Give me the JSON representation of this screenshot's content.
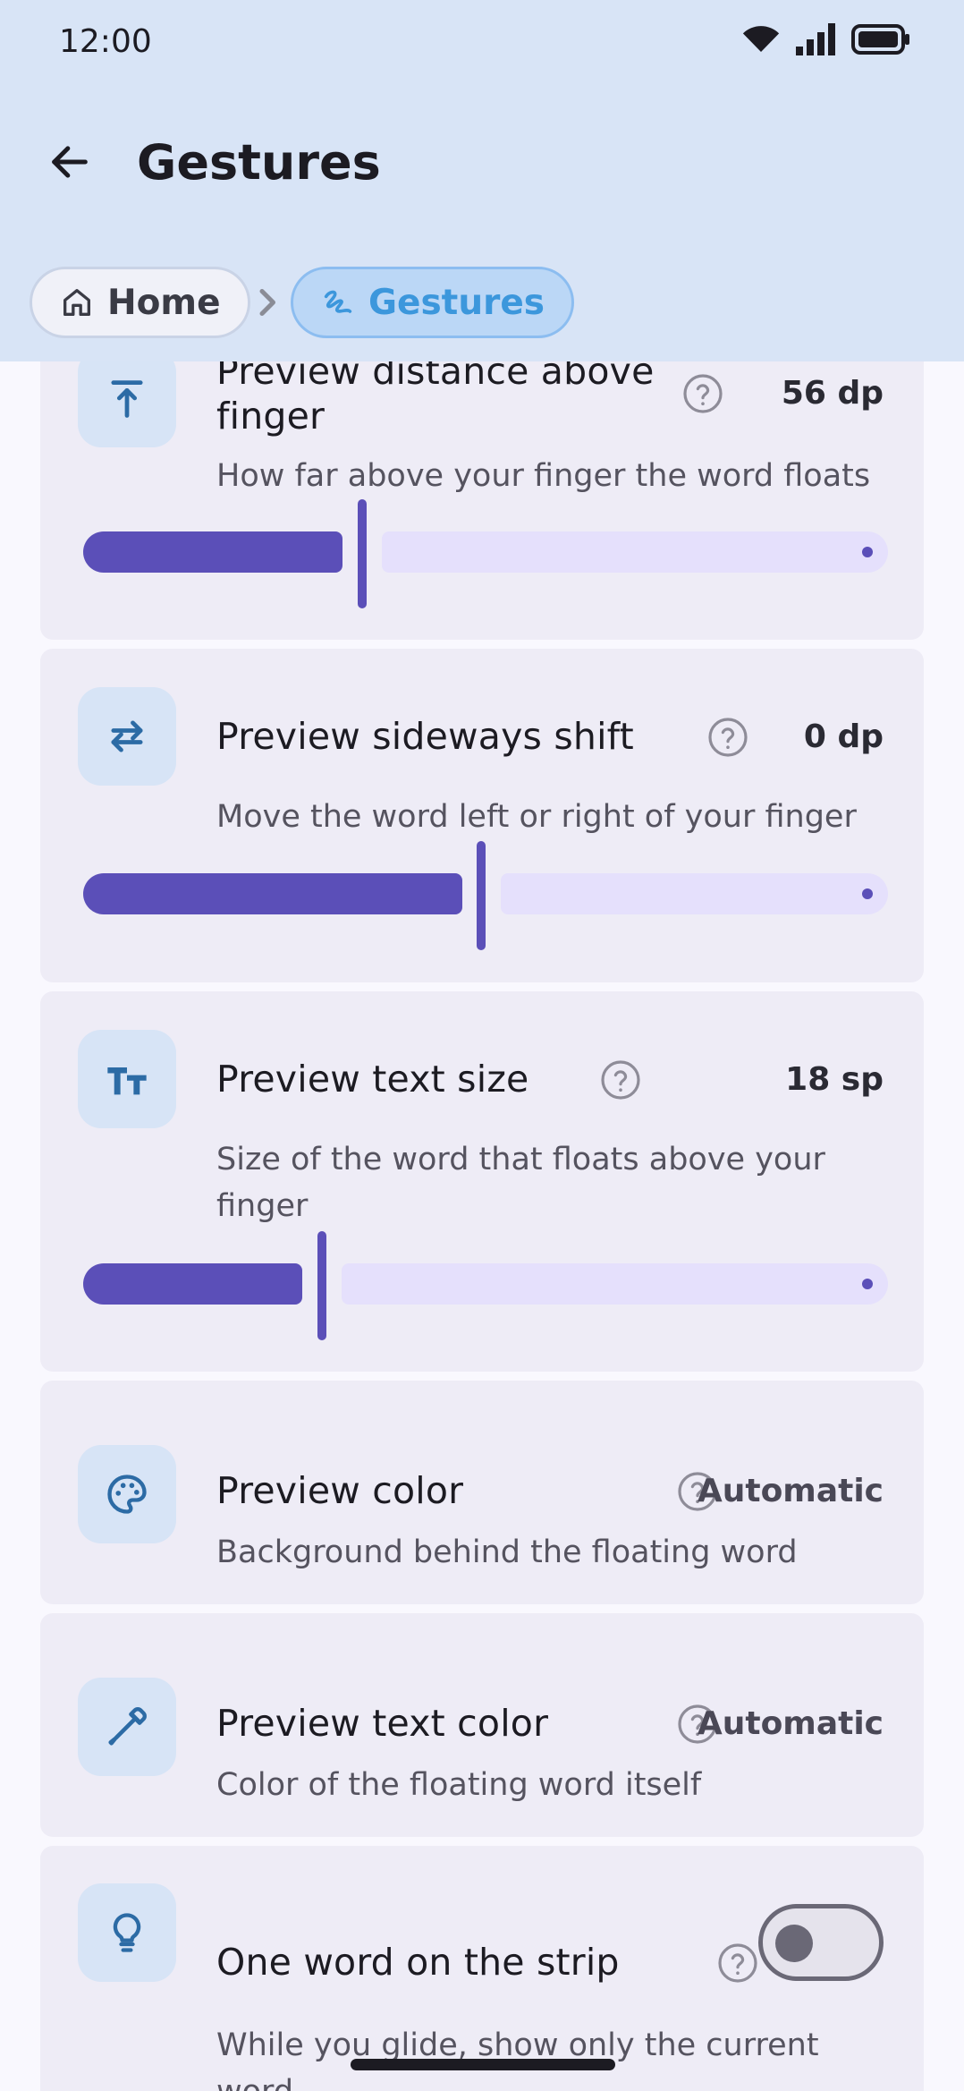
{
  "status": {
    "time": "12:00"
  },
  "header": {
    "title": "Gestures"
  },
  "breadcrumb": {
    "home": "Home",
    "current": "Gestures"
  },
  "settings": [
    {
      "title": "Preview distance above finger",
      "value": "56 dp",
      "description": "How far above your finger the word floats",
      "icon": "arrow-up-to-line-icon",
      "slider_fraction": 0.34
    },
    {
      "title": "Preview sideways shift",
      "value": "0 dp",
      "description": "Move the word left or right of your finger",
      "icon": "swap-horizontal-icon",
      "slider_fraction": 0.5
    },
    {
      "title": "Preview text size",
      "value": "18 sp",
      "description": "Size of the word that floats above your finger",
      "icon": "text-size-icon",
      "slider_fraction": 0.29
    },
    {
      "title": "Preview color",
      "value": "Automatic",
      "description": "Background behind the floating word",
      "icon": "palette-icon"
    },
    {
      "title": "Preview text color",
      "value": "Automatic",
      "description": "Color of the floating word itself",
      "icon": "eyedropper-icon"
    },
    {
      "title": "One word on the strip",
      "description": "While you glide, show only the current word",
      "icon": "lightbulb-icon",
      "toggle_on": false
    }
  ],
  "colors": {
    "accent": "#5B4FB8",
    "track_inactive": "#E5E0FC",
    "header_bg": "#D8E4F6",
    "card_bg": "#EEECF6",
    "icon_bg": "#D7E4F6",
    "icon_fg": "#2C6BA5"
  }
}
